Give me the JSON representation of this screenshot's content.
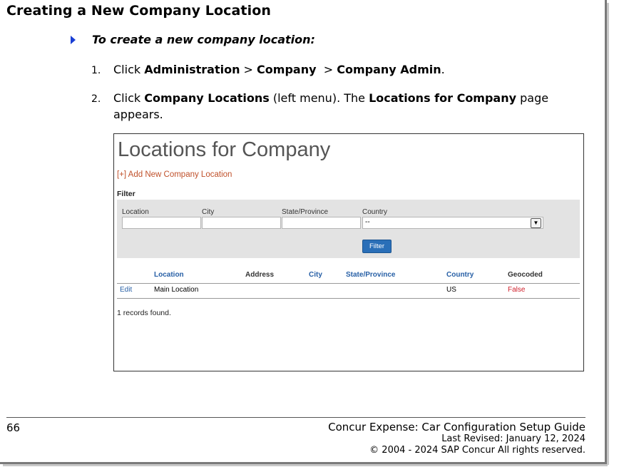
{
  "section_title": "Creating a New Company Location",
  "procedure_heading": "To create a new company location:",
  "steps": [
    {
      "number": "1.",
      "t1": "Click ",
      "b1": "Administration",
      "t2": " > ",
      "b2": "Company",
      "t3": "  > ",
      "b3": "Company Admin",
      "t4": "."
    },
    {
      "number": "2.",
      "t1": "Click ",
      "b1": "Company Locations",
      "t2": " (left menu). The ",
      "b2": "Locations for Company",
      "t3": " page",
      "t4": "appears."
    }
  ],
  "screenshot": {
    "title": "Locations for Company",
    "add_link": "[+] Add New Company Location",
    "filter_label": "Filter",
    "filter": {
      "location_label": "Location",
      "city_label": "City",
      "state_label": "State/Province",
      "country_label": "Country",
      "country_value": "--",
      "button": "Filter"
    },
    "columns": {
      "location": "Location",
      "address": "Address",
      "city": "City",
      "state": "State/Province",
      "country": "Country",
      "geocoded": "Geocoded"
    },
    "rows": [
      {
        "edit": "Edit",
        "location": "Main Location",
        "address": "",
        "city": "",
        "state": "",
        "country": "US",
        "geocoded": "False"
      }
    ],
    "records_found": "1 records found."
  },
  "footer": {
    "page_number": "66",
    "guide_title": "Concur Expense: Car Configuration Setup Guide",
    "last_revised": "Last Revised: January 12, 2024",
    "copyright": "© 2004 - 2024 SAP Concur All rights reserved."
  },
  "colors": {
    "procedure_arrow": "#1a3fd4",
    "link_orange": "#c0512b",
    "header_blue": "#2860a6",
    "false_red": "#d0202c",
    "button_blue": "#2a6fb8"
  }
}
